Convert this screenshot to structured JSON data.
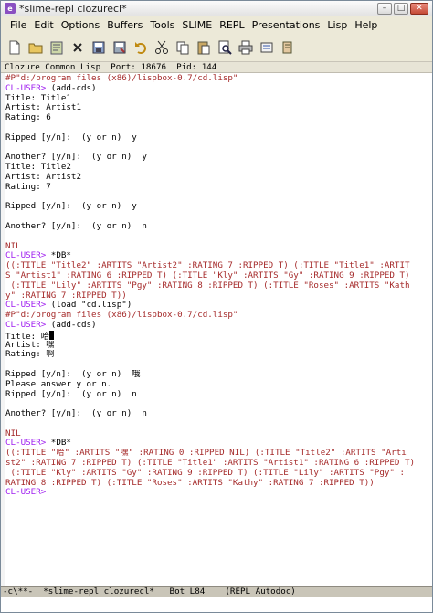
{
  "window": {
    "title": "*slime-repl clozurecl*",
    "app_icon": "emacs-icon",
    "controls": [
      "minimize",
      "maximize",
      "close"
    ]
  },
  "menubar": {
    "items": [
      "File",
      "Edit",
      "Options",
      "Buffers",
      "Tools",
      "SLIME",
      "REPL",
      "Presentations",
      "Lisp",
      "Help"
    ]
  },
  "toolbar": {
    "tools": [
      "new-file-icon",
      "open-folder-icon",
      "open-dired-icon",
      "close-icon",
      "save-icon",
      "save-as-icon",
      "undo-icon",
      "cut-icon",
      "copy-icon",
      "paste-icon",
      "search-icon",
      "print-icon",
      "preferences-icon",
      "help-icon"
    ]
  },
  "header_line": "Clozure Common Lisp  Port: 18676  Pid: 144",
  "repl_lines": [
    {
      "segs": [
        {
          "t": "#P\"d:/program files (x86)/lispbox-0.7/cd.lisp\"",
          "c": "red"
        }
      ]
    },
    {
      "segs": [
        {
          "t": "CL-USER> ",
          "c": "purple"
        },
        {
          "t": "(add-cds)",
          "c": "black"
        }
      ]
    },
    {
      "segs": [
        {
          "t": "Title: Title1",
          "c": "black"
        }
      ]
    },
    {
      "segs": [
        {
          "t": "Artist: Artist1",
          "c": "black"
        }
      ]
    },
    {
      "segs": [
        {
          "t": "Rating: 6",
          "c": "black"
        }
      ]
    },
    {
      "segs": []
    },
    {
      "segs": [
        {
          "t": "Ripped [y/n]:  (y or n)  y",
          "c": "black"
        }
      ]
    },
    {
      "segs": []
    },
    {
      "segs": [
        {
          "t": "Another? [y/n]:  (y or n)  y",
          "c": "black"
        }
      ]
    },
    {
      "segs": [
        {
          "t": "Title: Title2",
          "c": "black"
        }
      ]
    },
    {
      "segs": [
        {
          "t": "Artist: Artist2",
          "c": "black"
        }
      ]
    },
    {
      "segs": [
        {
          "t": "Rating: 7",
          "c": "black"
        }
      ]
    },
    {
      "segs": []
    },
    {
      "segs": [
        {
          "t": "Ripped [y/n]:  (y or n)  y",
          "c": "black"
        }
      ]
    },
    {
      "segs": []
    },
    {
      "segs": [
        {
          "t": "Another? [y/n]:  (y or n)  n",
          "c": "black"
        }
      ]
    },
    {
      "segs": []
    },
    {
      "segs": [
        {
          "t": "NIL",
          "c": "red"
        }
      ]
    },
    {
      "segs": [
        {
          "t": "CL-USER> ",
          "c": "purple"
        },
        {
          "t": "*DB*",
          "c": "black"
        }
      ]
    },
    {
      "segs": [
        {
          "t": "((:TITLE \"Title2\" :ARTITS \"Artist2\" :RATING 7 :RIPPED T) (:TITLE \"Title1\" :ARTIT",
          "c": "red"
        }
      ]
    },
    {
      "segs": [
        {
          "t": "S \"Artist1\" :RATING 6 :RIPPED T) (:TITLE \"Kly\" :ARTITS \"Gy\" :RATING 9 :RIPPED T)",
          "c": "red"
        }
      ]
    },
    {
      "segs": [
        {
          "t": " (:TITLE \"Lily\" :ARTITS \"Pgy\" :RATING 8 :RIPPED T) (:TITLE \"Roses\" :ARTITS \"Kath",
          "c": "red"
        }
      ]
    },
    {
      "segs": [
        {
          "t": "y\" :RATING 7 :RIPPED T))",
          "c": "red"
        }
      ]
    },
    {
      "segs": [
        {
          "t": "CL-USER> ",
          "c": "purple"
        },
        {
          "t": "(load \"cd.lisp\")",
          "c": "black"
        }
      ]
    },
    {
      "segs": [
        {
          "t": "#P\"d:/program files (x86)/lispbox-0.7/cd.lisp\"",
          "c": "red"
        }
      ]
    },
    {
      "segs": [
        {
          "t": "CL-USER> ",
          "c": "purple"
        },
        {
          "t": "(add-cds)",
          "c": "black"
        }
      ]
    },
    {
      "segs": [
        {
          "t": "Title: 哈",
          "c": "black"
        },
        {
          "t": "",
          "c": "cursor"
        }
      ]
    },
    {
      "segs": [
        {
          "t": "Artist: 嘿",
          "c": "black"
        }
      ]
    },
    {
      "segs": [
        {
          "t": "Rating: 啊",
          "c": "black"
        }
      ]
    },
    {
      "segs": []
    },
    {
      "segs": [
        {
          "t": "Ripped [y/n]:  (y or n)  哦",
          "c": "black"
        }
      ]
    },
    {
      "segs": [
        {
          "t": "Please answer y or n.",
          "c": "black"
        }
      ]
    },
    {
      "segs": [
        {
          "t": "Ripped [y/n]:  (y or n)  n",
          "c": "black"
        }
      ]
    },
    {
      "segs": []
    },
    {
      "segs": [
        {
          "t": "Another? [y/n]:  (y or n)  n",
          "c": "black"
        }
      ]
    },
    {
      "segs": []
    },
    {
      "segs": [
        {
          "t": "NIL",
          "c": "red"
        }
      ]
    },
    {
      "segs": [
        {
          "t": "CL-USER> ",
          "c": "purple"
        },
        {
          "t": "*DB*",
          "c": "black"
        }
      ]
    },
    {
      "segs": [
        {
          "t": "((:TITLE \"哈\" :ARTITS \"嘿\" :RATING 0 :RIPPED NIL) (:TITLE \"Title2\" :ARTITS \"Arti",
          "c": "red"
        }
      ]
    },
    {
      "segs": [
        {
          "t": "st2\" :RATING 7 :RIPPED T) (:TITLE \"Title1\" :ARTITS \"Artist1\" :RATING 6 :RIPPED T)",
          "c": "red"
        }
      ]
    },
    {
      "segs": [
        {
          "t": " (:TITLE \"Kly\" :ARTITS \"Gy\" :RATING 9 :RIPPED T) (:TITLE \"Lily\" :ARTITS \"Pgy\" :",
          "c": "red"
        }
      ]
    },
    {
      "segs": [
        {
          "t": "RATING 8 :RIPPED T) (:TITLE \"Roses\" :ARTITS \"Kathy\" :RATING 7 :RIPPED T))",
          "c": "red"
        }
      ]
    },
    {
      "segs": [
        {
          "t": "CL-USER> ",
          "c": "purple"
        }
      ]
    }
  ],
  "modeline": "-c\\**-  *slime-repl clozurecl*   Bot L84    (REPL Autodoc)",
  "colors": {
    "prompt": "#a020f0",
    "output": "#a52a2a",
    "input": "#000000",
    "modeline_bg": "#c9c5b8"
  }
}
